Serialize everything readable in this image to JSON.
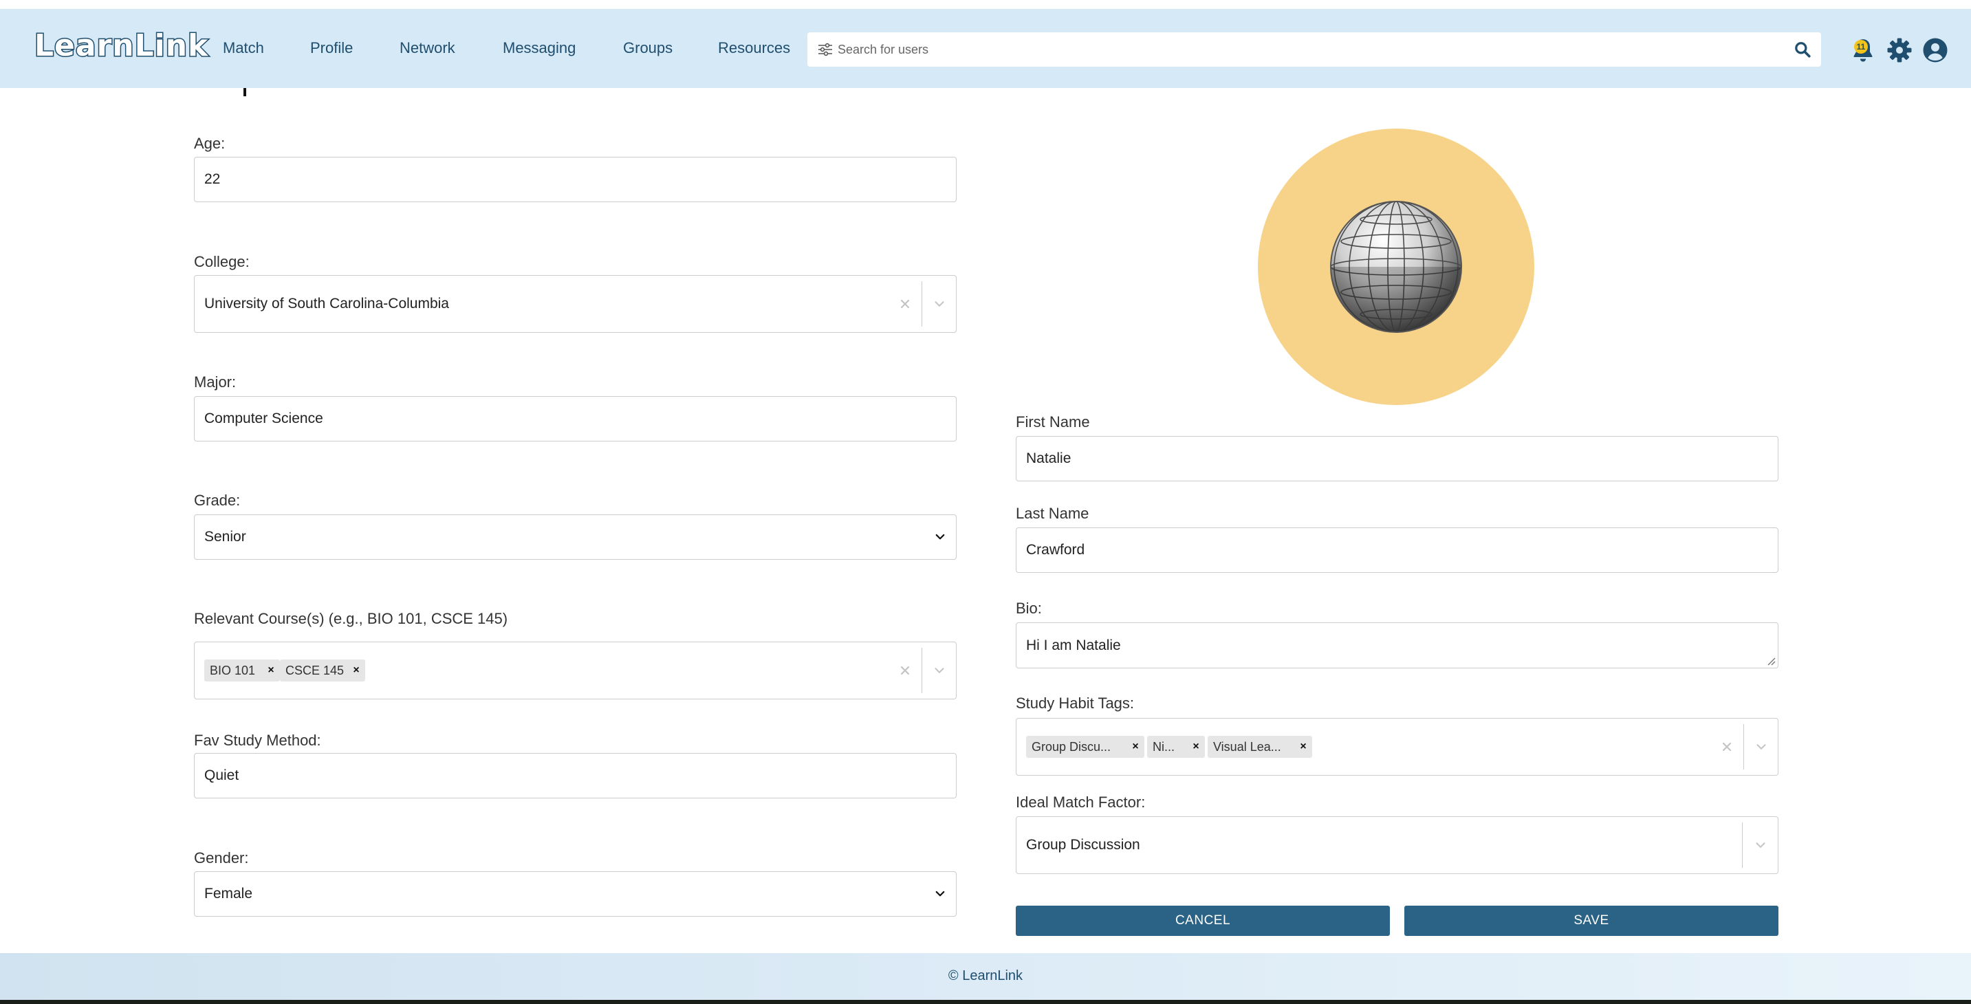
{
  "app": {
    "logo_text": "LearnLink",
    "nav": [
      "Match",
      "Profile",
      "Network",
      "Messaging",
      "Groups",
      "Resources"
    ],
    "search_placeholder": "Search for users",
    "notification_count": "11"
  },
  "form": {
    "age": {
      "label": "Age:",
      "value": "22"
    },
    "college": {
      "label": "College:",
      "value": "University of South Carolina-Columbia"
    },
    "major": {
      "label": "Major:",
      "value": "Computer Science"
    },
    "grade": {
      "label": "Grade:",
      "value": "Senior"
    },
    "courses": {
      "label": "Relevant Course(s) (e.g., BIO 101, CSCE 145)",
      "chips": [
        "BIO 101",
        "CSCE 145"
      ]
    },
    "study_method": {
      "label": "Fav Study Method:",
      "value": "Quiet"
    },
    "gender": {
      "label": "Gender:",
      "value": "Female"
    },
    "first_name": {
      "label": "First Name",
      "value": "Natalie"
    },
    "last_name": {
      "label": "Last Name",
      "value": "Crawford"
    },
    "bio": {
      "label": "Bio:",
      "value": "Hi I am Natalie"
    },
    "study_habit_tags": {
      "label": "Study Habit Tags:",
      "chips": [
        "Group Discu...",
        "Ni...",
        "Visual Lea..."
      ]
    },
    "ideal_match_factor": {
      "label": "Ideal Match Factor:",
      "value": "Group Discussion"
    }
  },
  "actions": {
    "cancel": "CANCEL",
    "save": "SAVE"
  },
  "footer": {
    "copyright": "© LearnLink"
  },
  "colors": {
    "navbar_bg": "#d6e9f6",
    "nav_text": "#1f4e6e",
    "button_bg": "#2a6385",
    "avatar_bg": "#f7d38a",
    "badge": "#f3c41a"
  },
  "icons": {
    "filter": "sliders-icon",
    "search": "search-icon",
    "notifications": "bell-icon",
    "settings": "gear-icon",
    "account": "user-circle-icon",
    "avatar": "disco-ball-icon"
  }
}
